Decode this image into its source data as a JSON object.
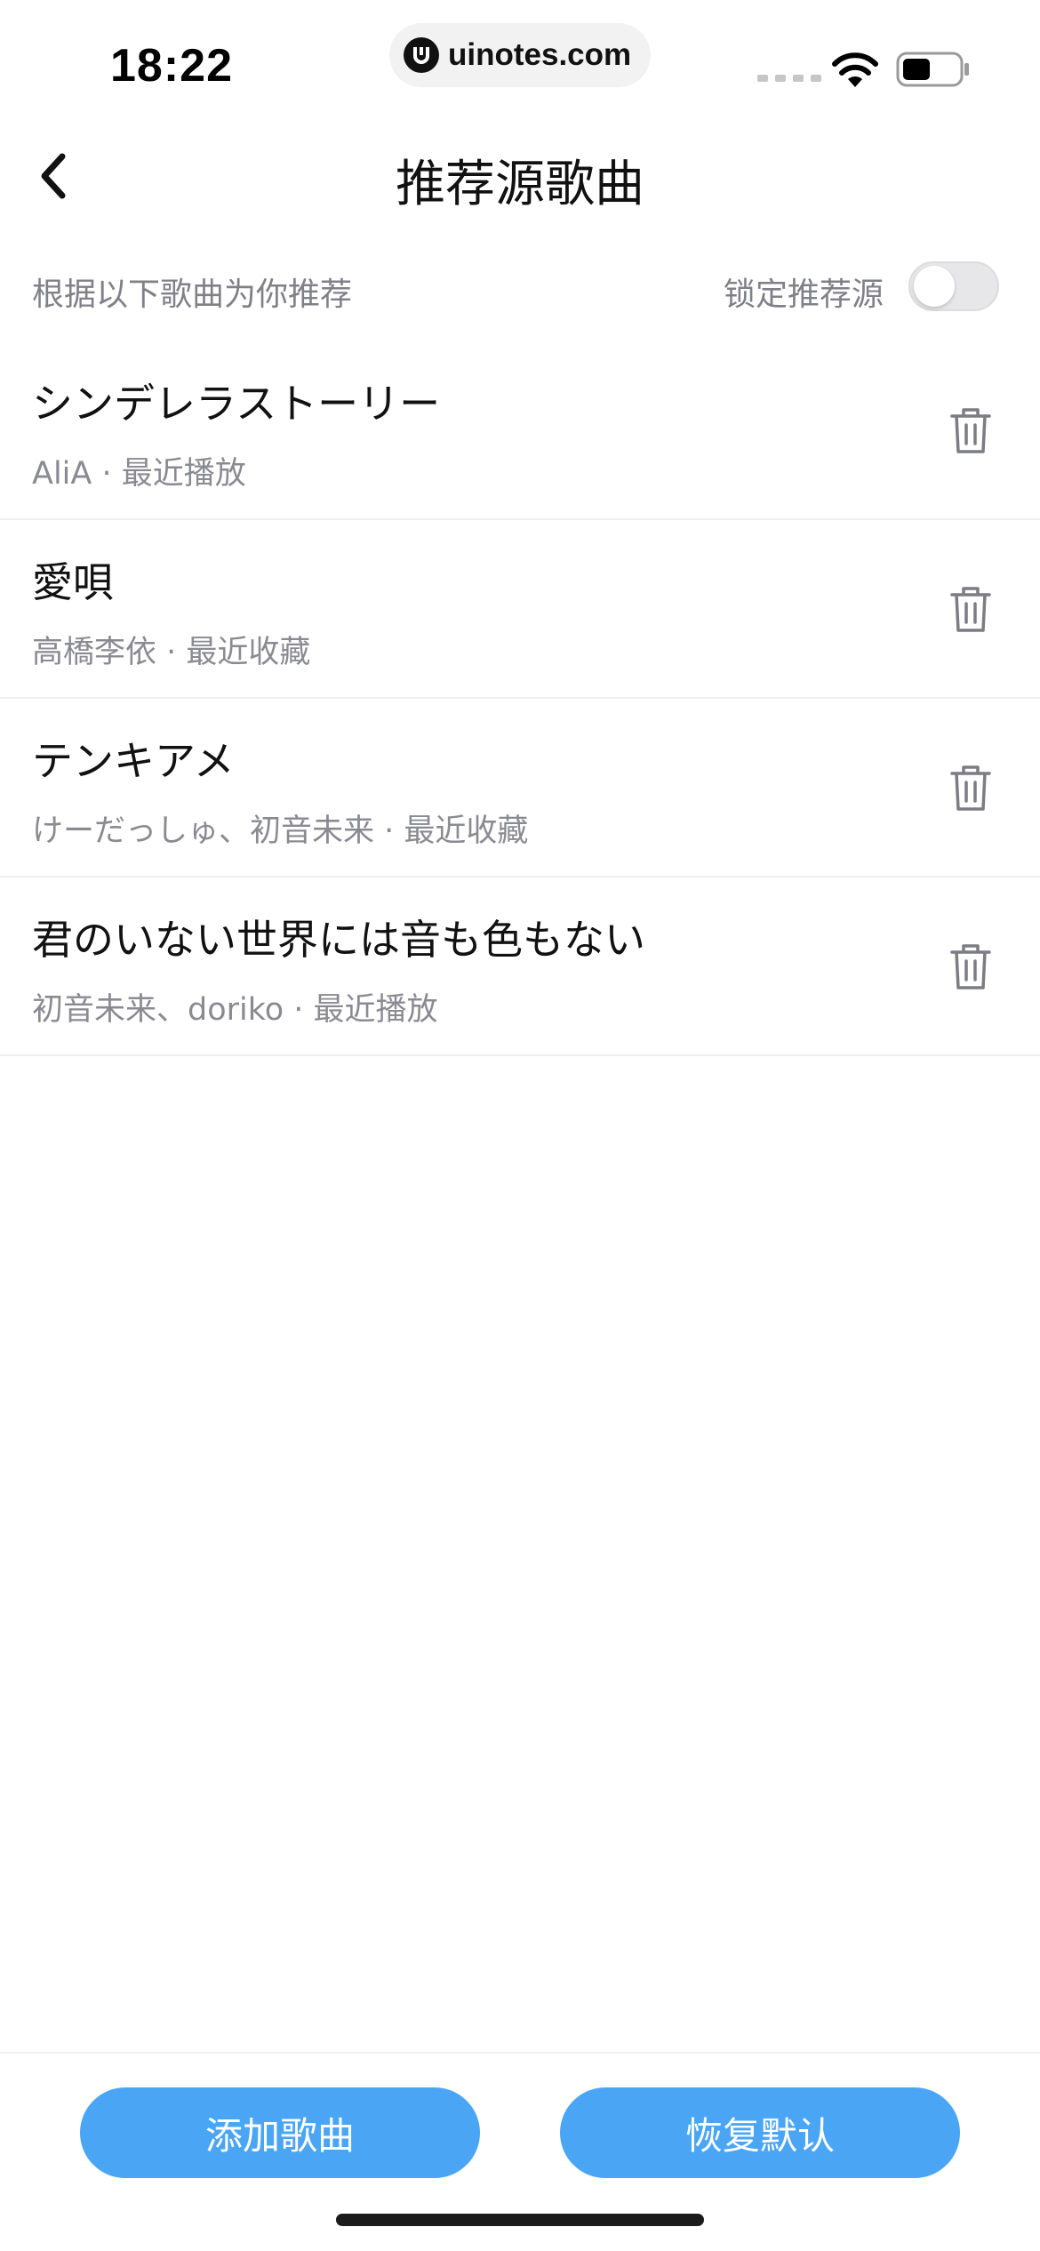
{
  "status_bar": {
    "time": "18:22",
    "url": "uinotes.com",
    "icons": [
      "signal-icon",
      "wifi-icon",
      "battery-icon"
    ]
  },
  "nav": {
    "title": "推荐源歌曲",
    "back_icon": "chevron-left-icon"
  },
  "header": {
    "description": "根据以下歌曲为你推荐",
    "lock_label": "锁定推荐源",
    "lock_enabled": false
  },
  "songs": [
    {
      "title": "シンデレラストーリー",
      "meta": "AliA · 最近播放"
    },
    {
      "title": "愛唄",
      "meta": "高橋李依 · 最近收藏"
    },
    {
      "title": "テンキアメ",
      "meta": "けーだっしゅ、初音未来 · 最近收藏"
    },
    {
      "title": "君のいない世界には音も色もない",
      "meta": "初音未来、doriko · 最近播放"
    }
  ],
  "actions": {
    "add_label": "添加歌曲",
    "reset_label": "恢复默认"
  },
  "colors": {
    "accent": "#4aa6f4",
    "secondary_text": "#8a8a93",
    "divider": "#f0f0f2"
  }
}
